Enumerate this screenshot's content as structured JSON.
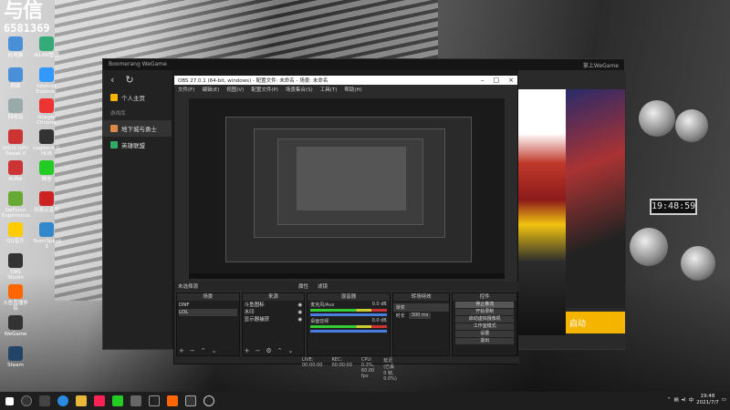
{
  "overlay": {
    "logo": "与信",
    "number": "6581369"
  },
  "desktop_icons": [
    {
      "label": "此电脑",
      "color": "#4a90d9"
    },
    {
      "label": "网络",
      "color": "#4a90d9"
    },
    {
      "label": "回收站",
      "color": "#9aa"
    },
    {
      "label": "ASUS GPU Tweak II",
      "color": "#c33"
    },
    {
      "label": "AURA",
      "color": "#c33"
    },
    {
      "label": "GeForce Experience",
      "color": "#6a3"
    },
    {
      "label": "QQ音乐",
      "color": "#fc0"
    },
    {
      "label": "OBS Studio",
      "color": "#333"
    },
    {
      "label": "斗鱼直播伴侣",
      "color": "#f60"
    },
    {
      "label": "WeGame",
      "color": "#333"
    },
    {
      "label": "Steam",
      "color": "#246"
    },
    {
      "label": "WLAN管理",
      "color": "#3a7"
    },
    {
      "label": "Internet Explorer",
      "color": "#39f"
    },
    {
      "label": "Google Chrome",
      "color": "#e33"
    },
    {
      "label": "Logitech G HUB",
      "color": "#333"
    },
    {
      "label": "微信",
      "color": "#2c2"
    },
    {
      "label": "网易云音乐",
      "color": "#c22"
    },
    {
      "label": "TeamSpeak 3",
      "color": "#38c"
    }
  ],
  "clock_widget": "19:48:59",
  "wegame": {
    "title_left": "Boomerang WeGame",
    "title_right": "掌上WeGame",
    "nav_back": "‹",
    "nav_refresh": "↻",
    "home": "个人主页",
    "section": "游戏库",
    "games": [
      "地下城与勇士",
      "英雄联盟"
    ],
    "launch": "启动",
    "side_label": "显示",
    "side_label2": "累计进度"
  },
  "obs": {
    "title": "OBS 27.0.1 (64-bit, windows) - 配置文件: 未命名 - 场景: 未命名",
    "menu": [
      "文件(F)",
      "编辑(E)",
      "视图(V)",
      "配置文件(P)",
      "场景集合(S)",
      "工具(T)",
      "帮助(H)"
    ],
    "srcbar": [
      "未选择源",
      "属性",
      "滤镜"
    ],
    "docks": {
      "scenes": {
        "title": "场景",
        "items": [
          "DNF",
          "LOL"
        ]
      },
      "sources": {
        "title": "来源",
        "items": [
          "斗鱼图标",
          "水印",
          "显示器捕获"
        ]
      },
      "mixer": {
        "title": "混音器",
        "rows": [
          {
            "name": "麦克风/Aux",
            "db": "0.0 dB"
          },
          {
            "name": "桌面音频",
            "db": "0.0 dB"
          }
        ]
      },
      "transitions": {
        "title": "转场特效",
        "fade": "渐变",
        "duration_label": "时长",
        "duration": "300 ms"
      },
      "controls": {
        "title": "控件",
        "buttons": [
          "停止推流",
          "开始录制",
          "启动虚拟摄像机",
          "工作室模式",
          "设置",
          "退出"
        ]
      }
    },
    "status": [
      "LIVE: 00:00:00",
      "REC: 00:00:00",
      "CPU: 0.3%, 60.00 fps",
      "延迟 (已丢 0 帧, 0.0%)"
    ]
  },
  "taskbar": {
    "time": "19:48",
    "date": "2021/7/7",
    "lang": "中"
  }
}
